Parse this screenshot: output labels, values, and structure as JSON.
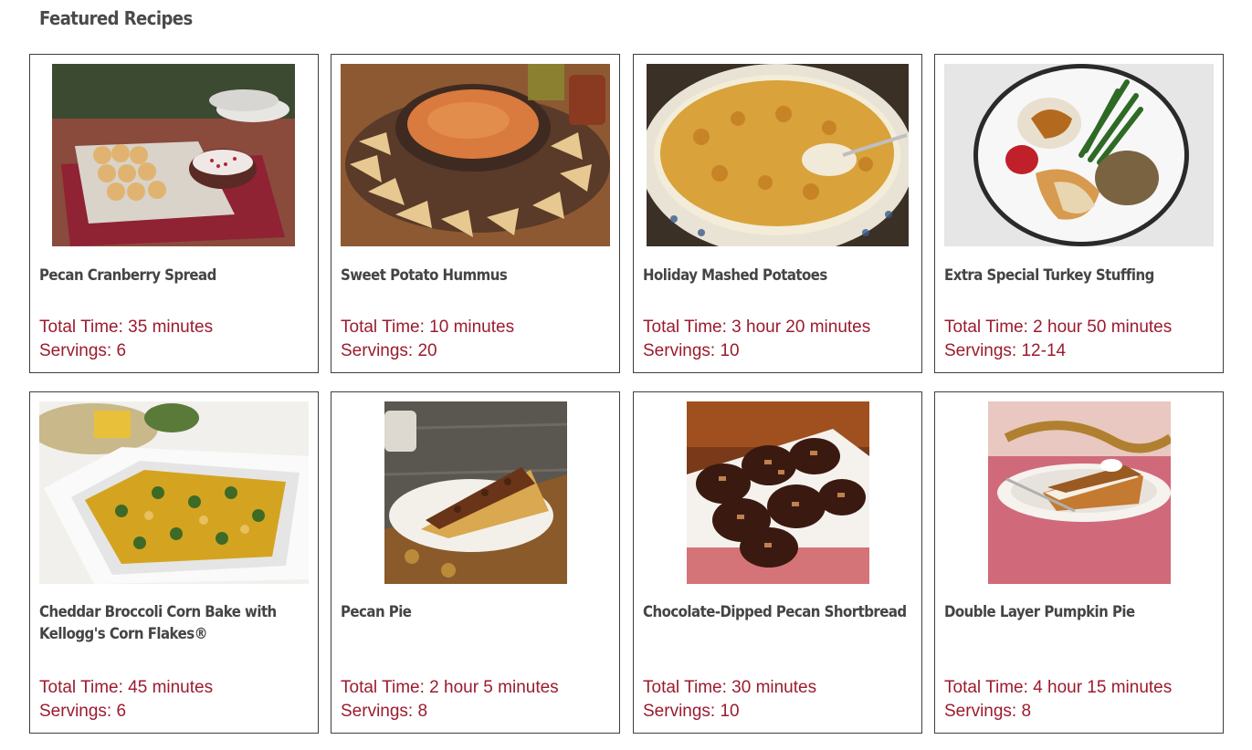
{
  "section": {
    "title": "Featured Recipes"
  },
  "labels": {
    "total_time": "Total Time:",
    "servings": "Servings:"
  },
  "colors": {
    "accent": "#9b1b2e",
    "border": "#3f3f3f",
    "title": "#444444"
  },
  "recipes": [
    {
      "name": "Pecan Cranberry Spread",
      "total_time": "35 minutes",
      "servings": "6",
      "image": "pecan-cranberry-spread-photo"
    },
    {
      "name": "Sweet Potato Hummus",
      "total_time": "10 minutes",
      "servings": "20",
      "image": "sweet-potato-hummus-photo"
    },
    {
      "name": "Holiday Mashed Potatoes",
      "total_time": "3 hour 20 minutes",
      "servings": "10",
      "image": "holiday-mashed-potatoes-photo"
    },
    {
      "name": "Extra Special Turkey Stuffing",
      "total_time": "2 hour 50 minutes",
      "servings": "12-14",
      "image": "turkey-stuffing-photo"
    },
    {
      "name": "Cheddar Broccoli Corn Bake with Kellogg's Corn Flakes®",
      "total_time": "45 minutes",
      "servings": "6",
      "image": "cheddar-broccoli-corn-bake-photo"
    },
    {
      "name": "Pecan Pie",
      "total_time": "2 hour 5 minutes",
      "servings": "8",
      "image": "pecan-pie-photo"
    },
    {
      "name": "Chocolate-Dipped Pecan Shortbread",
      "total_time": "30 minutes",
      "servings": "10",
      "image": "chocolate-pecan-shortbread-photo"
    },
    {
      "name": "Double Layer Pumpkin Pie",
      "total_time": "4 hour 15 minutes",
      "servings": "8",
      "image": "double-layer-pumpkin-pie-photo"
    }
  ]
}
